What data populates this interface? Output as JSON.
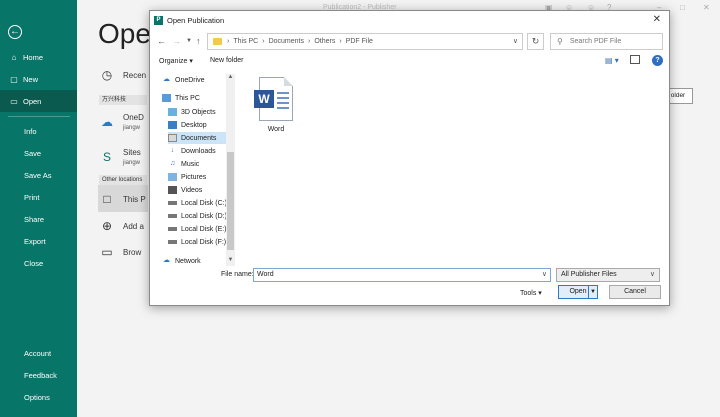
{
  "window": {
    "title": "Publication2 - Publisher"
  },
  "sidebar": {
    "items": [
      {
        "label": "Home",
        "icon": "home-icon"
      },
      {
        "label": "New",
        "icon": "new-file-icon"
      },
      {
        "label": "Open",
        "icon": "folder-open-icon"
      },
      {
        "label": "Info"
      },
      {
        "label": "Save"
      },
      {
        "label": "Save As"
      },
      {
        "label": "Print"
      },
      {
        "label": "Share"
      },
      {
        "label": "Export"
      },
      {
        "label": "Close"
      },
      {
        "label": "Account"
      },
      {
        "label": "Feedback"
      },
      {
        "label": "Options"
      }
    ]
  },
  "backstage": {
    "heading": "Open",
    "recent": "Recen",
    "group1": "万兴科技",
    "onedrive": "OneD",
    "onedrive_sub": "jiangw",
    "sites": "Sites",
    "sites_sub": "jiangw",
    "group2": "Other locations",
    "this_pc": "This P",
    "add": "Add a",
    "browse": "Brow",
    "folder_button": "older"
  },
  "dialog": {
    "title": "Open Publication",
    "breadcrumb": [
      "This PC",
      "Documents",
      "Others",
      "PDF File"
    ],
    "search_placeholder": "Search PDF File",
    "organize": "Organize",
    "new_folder": "New folder",
    "tree": [
      {
        "label": "OneDrive",
        "icon": "cloud-icon"
      },
      {
        "label": "This PC",
        "icon": "computer-icon"
      },
      {
        "label": "3D Objects",
        "icon": "cube-icon"
      },
      {
        "label": "Desktop",
        "icon": "desktop-icon"
      },
      {
        "label": "Documents",
        "icon": "documents-icon"
      },
      {
        "label": "Downloads",
        "icon": "download-icon"
      },
      {
        "label": "Music",
        "icon": "music-icon"
      },
      {
        "label": "Pictures",
        "icon": "pictures-icon"
      },
      {
        "label": "Videos",
        "icon": "video-icon"
      },
      {
        "label": "Local Disk (C:)",
        "icon": "disk-icon"
      },
      {
        "label": "Local Disk (D:)",
        "icon": "disk-icon"
      },
      {
        "label": "Local Disk (E:)",
        "icon": "disk-icon"
      },
      {
        "label": "Local Disk (F:)",
        "icon": "disk-icon"
      },
      {
        "label": "Network",
        "icon": "network-icon"
      }
    ],
    "selected_tree_item": "Documents",
    "files": [
      {
        "name": "Word",
        "icon": "word-file-icon"
      }
    ],
    "file_name_label": "File name:",
    "file_name_value": "Word",
    "file_type": "All Publisher Files",
    "tools": "Tools",
    "open": "Open",
    "cancel": "Cancel"
  },
  "colors": {
    "sidebar": "#077568",
    "sidebar_selected": "#0a5a50",
    "word_blue": "#2b5797",
    "accent": "#2f78c4"
  }
}
